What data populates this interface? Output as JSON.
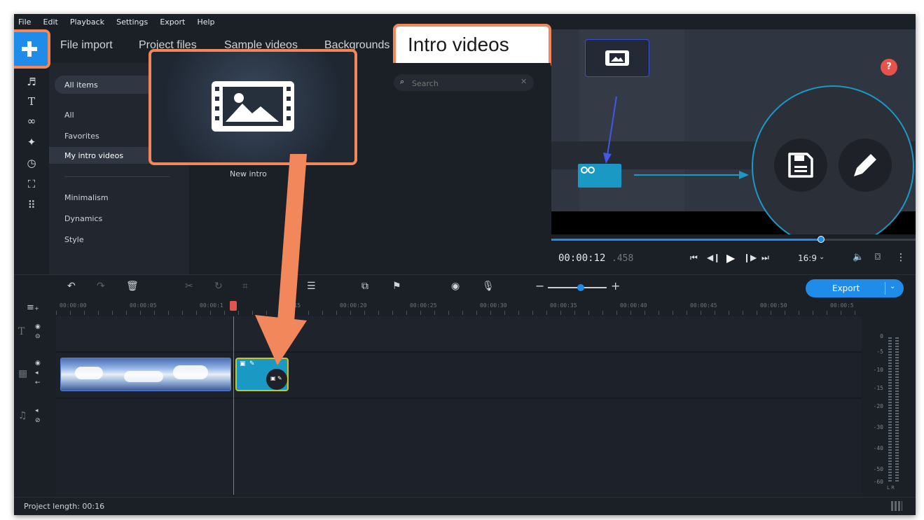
{
  "menu": [
    "File",
    "Edit",
    "Playback",
    "Settings",
    "Export",
    "Help"
  ],
  "tabs": {
    "file_import": "File import",
    "project_files": "Project files",
    "sample_videos": "Sample videos",
    "backgrounds": "Backgrounds",
    "intro_videos": "Intro videos"
  },
  "category_dropdown": "All items",
  "categories": {
    "all": "All",
    "favorites": "Favorites",
    "my_intro_videos": "My intro videos",
    "minimalism": "Minimalism",
    "dynamics": "Dynamics",
    "style": "Style"
  },
  "search": {
    "placeholder": "Search"
  },
  "new_intro_label": "New intro",
  "help_label": "?",
  "player": {
    "time_main": "00:00:12",
    "time_ms": ".458",
    "aspect": "16:9",
    "progress": 0.74
  },
  "timeline": {
    "export_label": "Export",
    "ruler_labels": [
      "00:00:00",
      "00:00:05",
      "00:00:1",
      "00:15",
      "00:00:20",
      "00:00:25",
      "00:00:30",
      "00:00:35",
      "00:00:40",
      "00:00:45",
      "00:00:50",
      "00:00:5"
    ]
  },
  "meter": {
    "db_labels": [
      "0",
      "-5",
      "-10",
      "-15",
      "-20",
      "-30",
      "-40",
      "-50",
      "-60"
    ],
    "lr": "L R"
  },
  "status": {
    "project_length": "Project length: 00:16"
  },
  "colors": {
    "accent_blue": "#1e8ce8",
    "callout_orange": "#f2875b",
    "playhead_red": "#e0554e",
    "clip_selected": "#c8c422",
    "diagram_cyan": "#1b99c5"
  }
}
